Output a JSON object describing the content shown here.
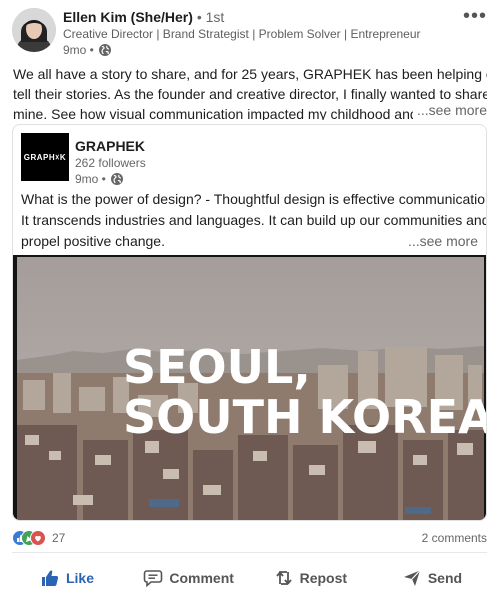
{
  "author": {
    "name": "Ellen Kim (She/Her)",
    "degree": "• 1st",
    "headline": "Creative Director | Brand Strategist | Problem Solver | Entrepreneur",
    "time": "9mo •",
    "visibility_icon": "globe-icon"
  },
  "post": {
    "lines": [
      "We all have a story to share, and for 25 years, GRAPHEK has been helping clients",
      "tell their stories. As the founder and creative director, I finally wanted to share",
      "mine. See how visual communication impacted my childhood and how it shaped me"
    ],
    "see_more": "...see more"
  },
  "shared_post": {
    "logo_text": "GRAPH☓K",
    "company": "GRAPHEK",
    "followers": "262 followers",
    "time": "9mo •",
    "lines": [
      "What is the power of design? - Thoughtful design is effective communication.",
      "It transcends industries and languages. It can build up our communities and",
      "propel positive change."
    ],
    "see_more": "...see more",
    "media_title_line1": "SEOUL,",
    "media_title_line2": "SOUTH KOREA"
  },
  "social": {
    "reaction_count": "27",
    "comments": "2 comments",
    "reaction_icons": [
      "like-icon",
      "celebrate-icon",
      "support-icon"
    ]
  },
  "actions": {
    "like": "Like",
    "comment": "Comment",
    "repost": "Repost",
    "send": "Send"
  },
  "colors": {
    "like_blue": "#2b63b5",
    "celebrate_green": "#44a05b",
    "support_red": "#d9534f"
  }
}
